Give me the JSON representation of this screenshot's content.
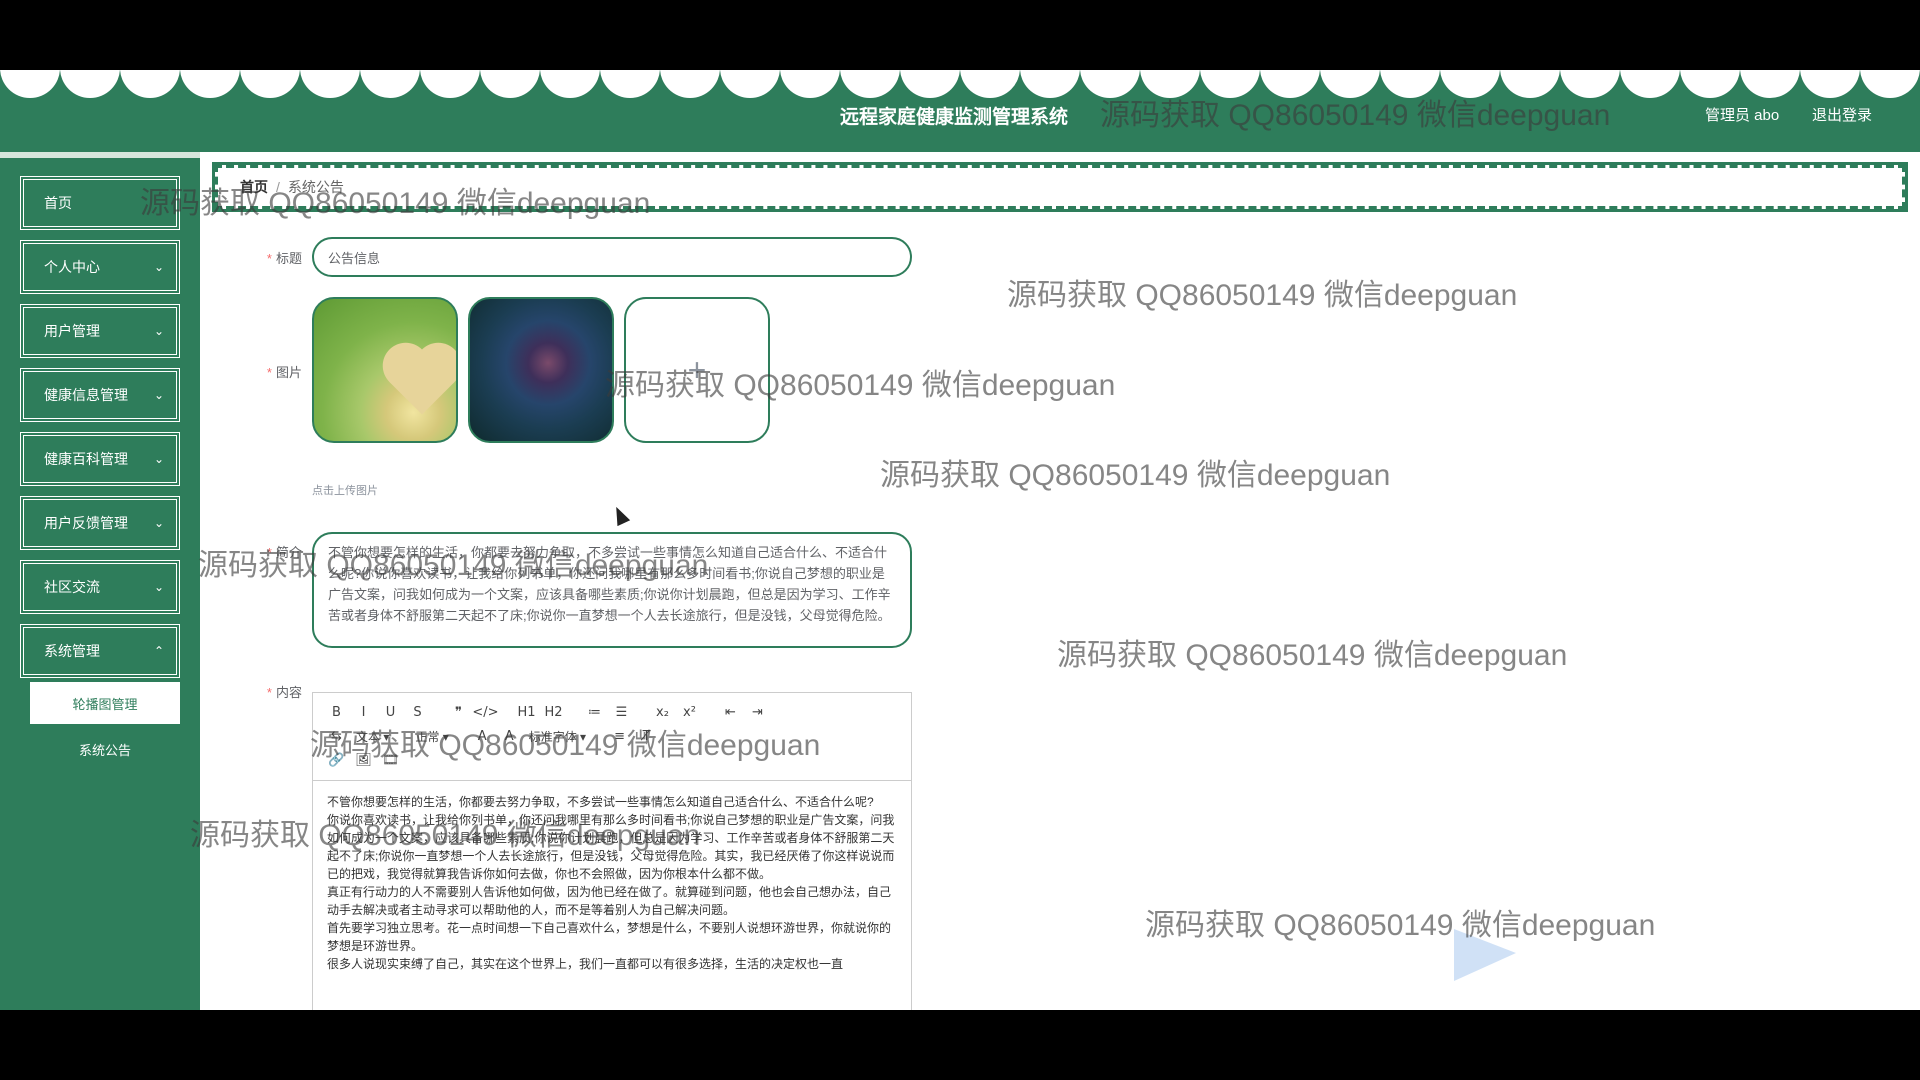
{
  "header": {
    "title": "远程家庭健康监测管理系统",
    "user": "管理员 abo",
    "logout": "退出登录"
  },
  "sidebar": {
    "items": [
      {
        "label": "首页",
        "expandable": false
      },
      {
        "label": "个人中心",
        "expandable": true
      },
      {
        "label": "用户管理",
        "expandable": true
      },
      {
        "label": "健康信息管理",
        "expandable": true
      },
      {
        "label": "健康百科管理",
        "expandable": true
      },
      {
        "label": "用户反馈管理",
        "expandable": true
      },
      {
        "label": "社区交流",
        "expandable": true
      },
      {
        "label": "系统管理",
        "expandable": true
      }
    ],
    "submenu": [
      "轮播图管理",
      "系统公告"
    ]
  },
  "breadcrumb": {
    "home": "首页",
    "current": "系统公告"
  },
  "form": {
    "title_label": "标题",
    "title_value": "公告信息",
    "image_label": "图片",
    "upload_plus": "+",
    "upload_tip": "点击上传图片",
    "intro_label": "简介",
    "intro_value": "不管你想要怎样的生活，你都要去努力争取，不多尝试一些事情怎么知道自己适合什么、不适合什么呢?你说你喜欢读书，让我给你列书单，你还问我哪里有那么多时间看书;你说自己梦想的职业是广告文案，问我如何成为一个文案，应该具备哪些素质;你说你计划晨跑，但总是因为学习、工作辛苦或者身体不舒服第二天起不了床;你说你一直梦想一个人去长途旅行，但是没钱，父母觉得危险。",
    "content_label": "内容",
    "content_paragraphs": [
      "不管你想要怎样的生活，你都要去努力争取，不多尝试一些事情怎么知道自己适合什么、不适合什么呢?",
      "你说你喜欢读书，让我给你列书单，你还问我哪里有那么多时间看书;你说自己梦想的职业是广告文案，问我如何成为一个文案，应该具备哪些素质;你说你计划晨跑，但总是因为学习、工作辛苦或者身体不舒服第二天起不了床;你说你一直梦想一个人去长途旅行，但是没钱，父母觉得危险。其实，我已经厌倦了你这样说说而已的把戏，我觉得就算我告诉你如何去做，你也不会照做，因为你根本什么都不做。",
      "真正有行动力的人不需要别人告诉他如何做，因为他已经在做了。就算碰到问题，他也会自己想办法，自己动手去解决或者主动寻求可以帮助他的人，而不是等着别人为自己解决问题。",
      "首先要学习独立思考。花一点时间想一下自己喜欢什么，梦想是什么，不要别人说想环游世界，你就说你的梦想是环游世界。",
      "很多人说现实束缚了自己，其实在这个世界上，我们一直都可以有很多选择，生活的决定权也一直"
    ]
  },
  "editor_toolbar": {
    "row1": [
      "B",
      "I",
      "U",
      "S",
      "❞",
      "</>",
      "H1",
      "H2",
      "≔",
      "☰",
      "x₂",
      "x²",
      "⇤",
      "⇥"
    ],
    "row2": [
      "⇆",
      "文本",
      "正常",
      "A",
      "A",
      "标准字体",
      "≡",
      "T̸"
    ],
    "row3": [
      "🔗",
      "🖼",
      "🎞"
    ]
  },
  "watermark": "源码获取 QQ86050149 微信deepguan",
  "colors": {
    "brand": "#2e7d5b",
    "required": "#f56c6c"
  }
}
